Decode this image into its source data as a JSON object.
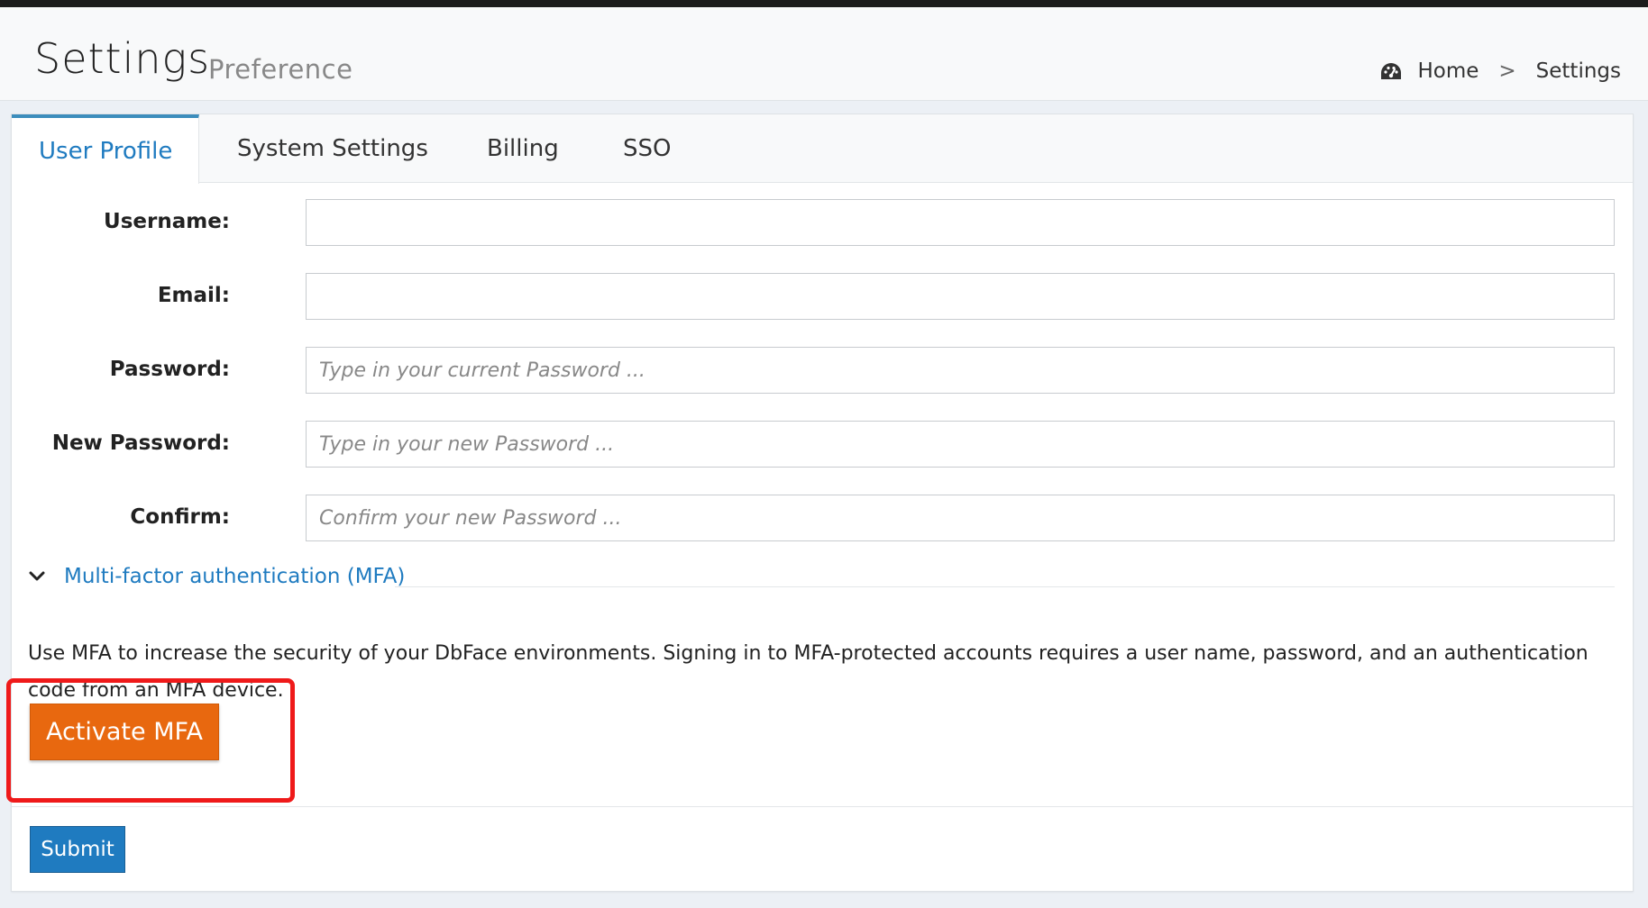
{
  "header": {
    "title": "Settings",
    "subtitle": "Preference",
    "breadcrumb": {
      "home_icon": "dashboard-icon",
      "home": "Home",
      "separator": ">",
      "current": "Settings"
    }
  },
  "tabs": [
    {
      "label": "User Profile",
      "active": true
    },
    {
      "label": "System Settings",
      "active": false
    },
    {
      "label": "Billing",
      "active": false
    },
    {
      "label": "SSO",
      "active": false
    }
  ],
  "form": {
    "username": {
      "label": "Username:",
      "value": "",
      "placeholder": ""
    },
    "email": {
      "label": "Email:",
      "value": "",
      "placeholder": ""
    },
    "password": {
      "label": "Password:",
      "value": "",
      "placeholder": "Type in your current Password ..."
    },
    "new_password": {
      "label": "New Password:",
      "value": "",
      "placeholder": "Type in your new Password ..."
    },
    "confirm": {
      "label": "Confirm:",
      "value": "",
      "placeholder": "Confirm your new Password ..."
    }
  },
  "mfa": {
    "toggle_icon": "chevron-down-icon",
    "title": "Multi-factor authentication (MFA)",
    "description": "Use MFA to increase the security of your DbFace environments. Signing in to MFA-protected accounts requires a user name, password, and an authentication code from an MFA device.",
    "activate_label": "Activate MFA"
  },
  "actions": {
    "submit_label": "Submit"
  },
  "colors": {
    "accent": "#1f7bc0",
    "activate": "#e8680f",
    "highlight": "#ef1a1a"
  }
}
